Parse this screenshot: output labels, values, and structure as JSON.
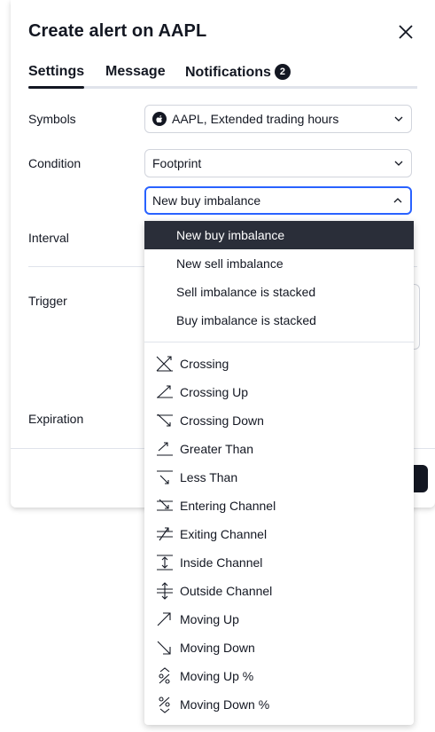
{
  "dialog": {
    "title": "Create alert on AAPL",
    "tabs": [
      {
        "label": "Settings",
        "active": true
      },
      {
        "label": "Message",
        "active": false
      },
      {
        "label": "Notifications",
        "badge": "2",
        "active": false
      }
    ],
    "fields": {
      "symbols_label": "Symbols",
      "symbols_value": "AAPL, Extended trading hours",
      "condition_label": "Condition",
      "condition_value": "Footprint",
      "condition_sub_value": "New buy imbalance",
      "interval_label": "Interval",
      "trigger_label": "Trigger",
      "expiration_label": "Expiration"
    }
  },
  "dropdown": {
    "options": [
      {
        "label": "New buy imbalance",
        "selected": true
      },
      {
        "label": "New sell imbalance",
        "selected": false
      },
      {
        "label": "Sell imbalance is stacked",
        "selected": false
      },
      {
        "label": "Buy imbalance is stacked",
        "selected": false
      }
    ],
    "operators": [
      {
        "label": "Crossing",
        "icon": "crossing-icon"
      },
      {
        "label": "Crossing Up",
        "icon": "crossing-up-icon"
      },
      {
        "label": "Crossing Down",
        "icon": "crossing-down-icon"
      },
      {
        "label": "Greater Than",
        "icon": "greater-than-icon"
      },
      {
        "label": "Less Than",
        "icon": "less-than-icon"
      },
      {
        "label": "Entering Channel",
        "icon": "entering-channel-icon"
      },
      {
        "label": "Exiting Channel",
        "icon": "exiting-channel-icon"
      },
      {
        "label": "Inside Channel",
        "icon": "inside-channel-icon"
      },
      {
        "label": "Outside Channel",
        "icon": "outside-channel-icon"
      },
      {
        "label": "Moving Up",
        "icon": "moving-up-icon"
      },
      {
        "label": "Moving Down",
        "icon": "moving-down-icon"
      },
      {
        "label": "Moving Up %",
        "icon": "moving-up-percent-icon"
      },
      {
        "label": "Moving Down %",
        "icon": "moving-down-percent-icon"
      }
    ]
  },
  "colors": {
    "accent": "#2962ff",
    "selected_bg": "#2a2e39",
    "text": "#131722",
    "border": "#d1d4dc"
  }
}
